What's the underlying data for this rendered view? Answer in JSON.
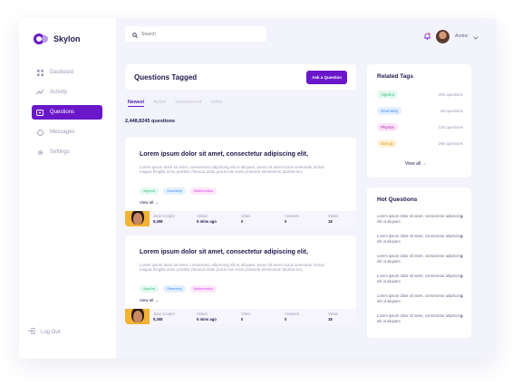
{
  "app": {
    "name": "Skylon"
  },
  "sidebar": {
    "items": [
      {
        "label": "Dasboard",
        "icon": "grid-icon"
      },
      {
        "label": "Activity",
        "icon": "chart-icon"
      },
      {
        "label": "Questions",
        "icon": "question-icon"
      },
      {
        "label": "Messages",
        "icon": "message-icon"
      },
      {
        "label": "Settings",
        "icon": "gear-icon"
      }
    ],
    "logout": "Log Out"
  },
  "topbar": {
    "search_placeholder": "Search",
    "user_name": "Andrei"
  },
  "main": {
    "title": "Questions Tagged",
    "ask_label": "Ask a Question",
    "tabs": [
      "Newest",
      "Active",
      "Unanswered",
      "Votes"
    ],
    "count": "2,448,8245 questions",
    "questions": [
      {
        "title": "Lorem ipsum dolor sit amet, consectetur adipiscing elit,",
        "body": "Lorem ipsum dolor sit amet, consectetur adipiscing elit ut aliquam, purus sit amet luctus venenatis, lectus magna fringilla urna, porttitor rhoncus dolor purus non enim praesent elementum facilisis leo,",
        "tags": [
          "Algebra",
          "Geometry",
          "Mathematics"
        ],
        "view_all": "View all",
        "author": "Jane Cooper",
        "author_score": "9,308",
        "asked_label": "Asked",
        "asked": "5 mins ago",
        "votes_label": "Votes",
        "votes": "0",
        "answers_label": "Answers",
        "answers": "0",
        "views_label": "Views",
        "views": "18"
      },
      {
        "title": "Lorem ipsum dolor sit amet, consectetur adipiscing elit,",
        "body": "Lorem ipsum dolor sit amet, consectetur adipiscing elit ut aliquam, purus sit amet luctus venenatis, lectus magna fringilla urna, porttitor rhoncus dolor purus non enim praesent elementum facilisis leo,",
        "tags": [
          "Algebra",
          "Geometry",
          "Mathematics"
        ],
        "view_all": "View all",
        "author": "Jane Cooper",
        "author_score": "9,308",
        "asked_label": "Asked",
        "asked": "5 mins ago",
        "votes_label": "Votes",
        "votes": "0",
        "answers_label": "Answers",
        "answers": "0",
        "views_label": "Views",
        "views": "18"
      }
    ]
  },
  "related": {
    "title": "Related Tags",
    "tags": [
      {
        "name": "Algebra",
        "count": "256 questions",
        "color": "#3bbf84",
        "bg": "#e4f9ef"
      },
      {
        "name": "Geometry",
        "count": "56 questions",
        "color": "#3b82f6",
        "bg": "#e4f0ff"
      },
      {
        "name": "Physics",
        "count": "126 questions",
        "color": "#a21caf",
        "bg": "#fbe4f7"
      },
      {
        "name": "Biology",
        "count": "256 questions",
        "color": "#d99a17",
        "bg": "#fff3d9"
      }
    ],
    "view_all": "View all"
  },
  "hot": {
    "title": "Hot Questions",
    "items": [
      "Lorem ipsum dolor sit amet, consectetur adipiscing elit ut aliquam",
      "Lorem ipsum dolor sit amet, consectetur adipiscing elit ut aliquam",
      "Lorem ipsum dolor sit amet, consectetur adipiscing elit ut aliquam",
      "Lorem ipsum dolor sit amet, consectetur adipiscing elit ut aliquam",
      "Lorem ipsum dolor sit amet, consectetur adipiscing elit ut aliquam",
      "Lorem ipsum dolor sit amet, consectetur adipiscing elit ut aliquam"
    ]
  },
  "colors": {
    "accent": "#6a17c9",
    "text": "#1f1b4d",
    "muted": "#9a98b3"
  }
}
